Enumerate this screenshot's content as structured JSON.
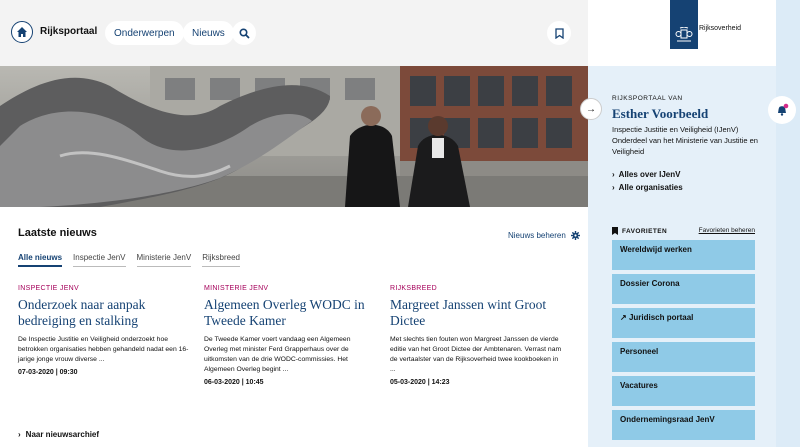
{
  "header": {
    "site_name": "Rijksportaal",
    "nav": [
      "Onderwerpen",
      "Nieuws"
    ],
    "home_icon": "home-icon",
    "search_icon": "search-icon",
    "bookmark_icon": "bookmark-icon"
  },
  "news": {
    "heading": "Laatste nieuws",
    "manage_label": "Nieuws beheren",
    "tabs": [
      "Alle nieuws",
      "Inspectie JenV",
      "Ministerie JenV",
      "Rijksbreed"
    ],
    "articles": [
      {
        "category": "INSPECTIE JENV",
        "title": "Onderzoek naar aanpak bedreiging en stalking",
        "summary": "De Inspectie Justitie en Veiligheid onderzoekt hoe betrokken organisaties hebben gehandeld nadat een 16-jarige jonge vrouw diverse ...",
        "date": "07-03-2020 | 09:30"
      },
      {
        "category": "MINISTERIE JENV",
        "title": "Algemeen Overleg WODC in Tweede Kamer",
        "summary": "De Tweede Kamer voert vandaag een Algemeen Overleg met minister Ferd Grapperhaus over de uitkomsten van de drie WODC-commissies. Het Algemeen Overleg begint ...",
        "date": "06-03-2020 | 10:45"
      },
      {
        "category": "RIJKSBREED",
        "title": "Margreet Janssen wint Groot Dictee",
        "summary": "Met slechts tien fouten won Margreet Janssen de vierde editie van het Groot Dictee der Ambtenaren. Verrast nam de vertaalster van de Rijksoverheid twee kookboeken in ...",
        "date": "05-03-2020 | 14:23"
      }
    ],
    "archive_label": "Naar nieuwsarchief"
  },
  "panel": {
    "logo_text": "Rijksoverheid",
    "kicker": "RIJKSPORTAAL VAN",
    "name": "Esther Voorbeeld",
    "description": "Inspectie Justitie en Veiligheid (IJenV) Onderdeel van het Ministerie van Justitie en Veiligheid",
    "links": [
      "Alles over IJenV",
      "Alle organisaties"
    ],
    "favorites_label": "FAVORIETEN",
    "favorites_manage": "Favorieten beheren",
    "favorites": [
      "Wereldwijd werken",
      "Dossier Corona",
      "Juridisch portaal",
      "Personeel",
      "Vacatures",
      "Ondernemingsraad JenV"
    ]
  },
  "colors": {
    "brand": "#154273",
    "accent": "#a5005a",
    "favorite_bg": "#8fcae7",
    "panel_bg": "#e5f0f9",
    "notification": "#d52b8a"
  }
}
